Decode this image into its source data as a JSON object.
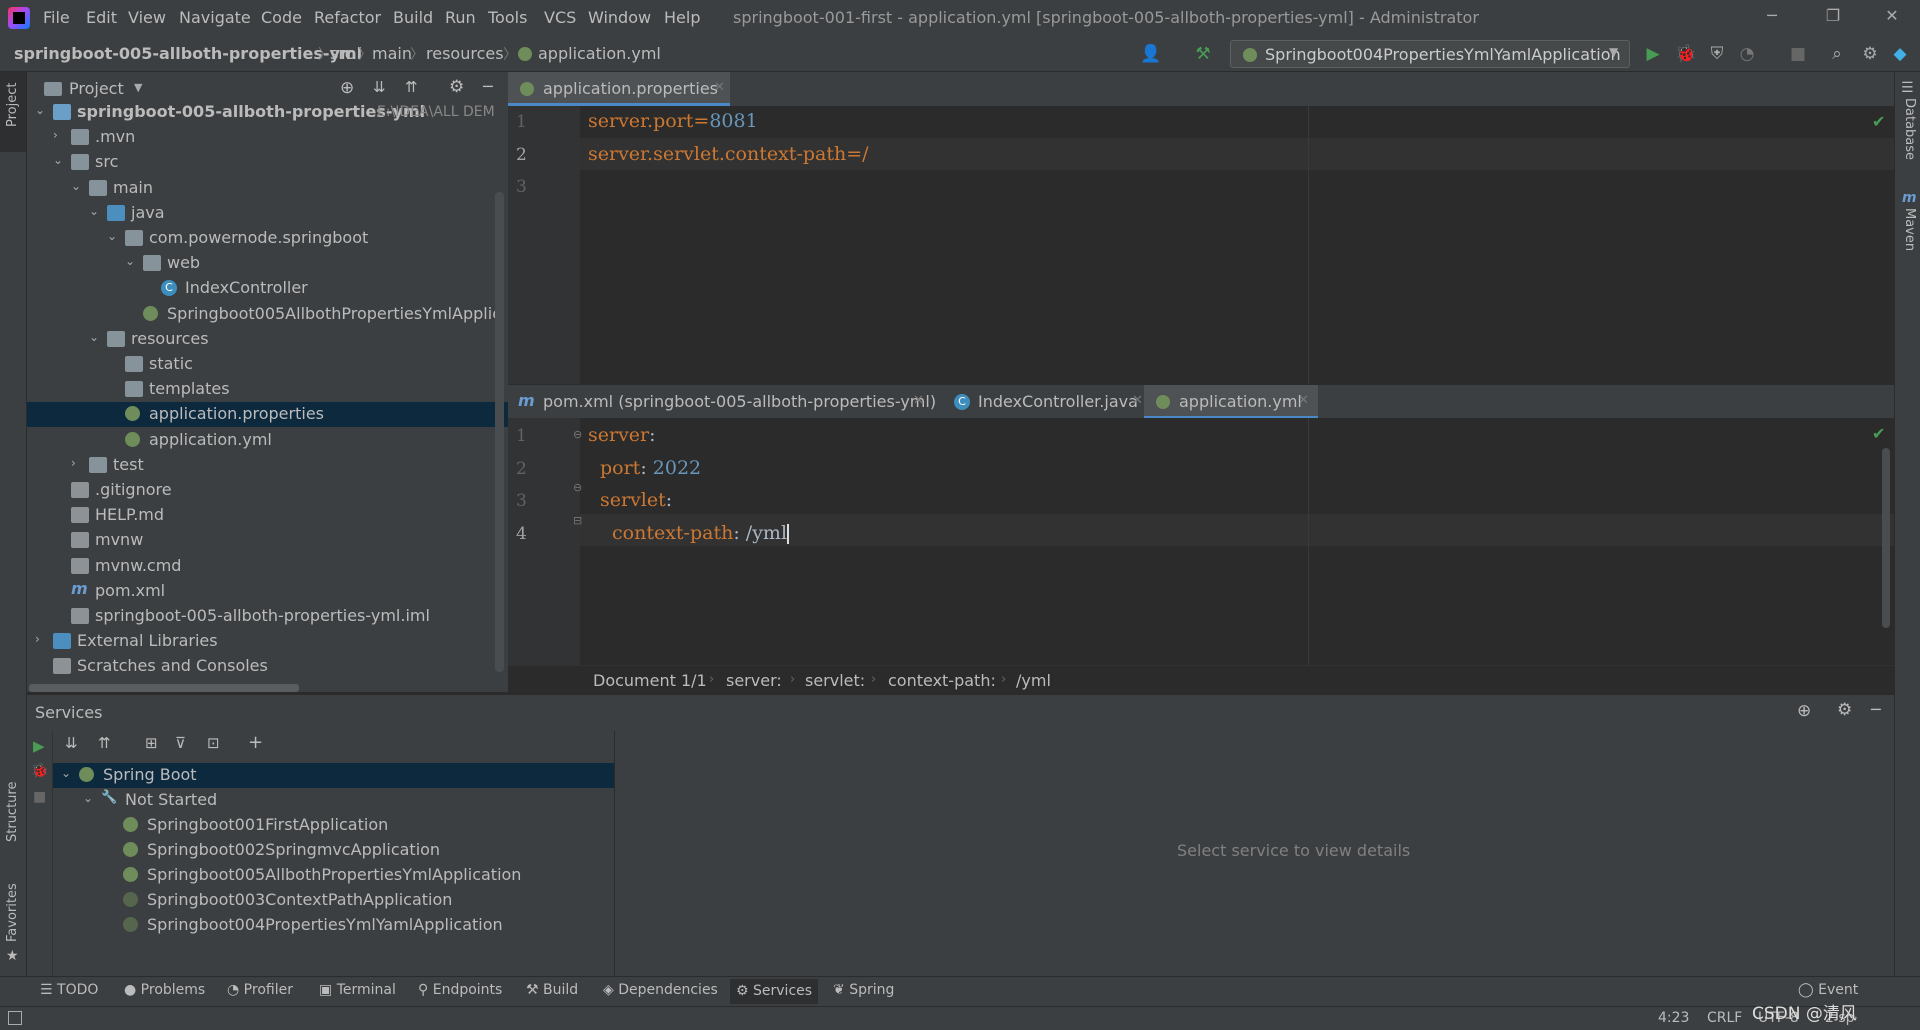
{
  "menu": [
    "File",
    "Edit",
    "View",
    "Navigate",
    "Code",
    "Refactor",
    "Build",
    "Run",
    "Tools",
    "VCS",
    "Window",
    "Help"
  ],
  "window_title": "springboot-001-first - application.yml [springboot-005-allboth-properties-yml] - Administrator",
  "breadcrumb": [
    "springboot-005-allboth-properties-yml",
    "src",
    "main",
    "resources",
    "application.yml"
  ],
  "run_config": "Springboot004PropertiesYmlYamlApplication",
  "left_stripe": {
    "project": "Project",
    "structure": "Structure",
    "favorites": "Favorites"
  },
  "right_stripe": {
    "database": "Database",
    "maven": "Maven"
  },
  "project_panel": {
    "title": "Project",
    "tree": [
      {
        "label": "springboot-005-allboth-properties-yml",
        "hint": "E:\\IDEA\\ALL DEM",
        "depth": 0,
        "arrow": "down",
        "icon": "module-folder",
        "bold": true
      },
      {
        "label": ".mvn",
        "depth": 1,
        "arrow": "right",
        "icon": "folder"
      },
      {
        "label": "src",
        "depth": 1,
        "arrow": "down",
        "icon": "folder"
      },
      {
        "label": "main",
        "depth": 2,
        "arrow": "down",
        "icon": "folder"
      },
      {
        "label": "java",
        "depth": 3,
        "arrow": "down",
        "icon": "source-folder"
      },
      {
        "label": "com.powernode.springboot",
        "depth": 4,
        "arrow": "down",
        "icon": "package"
      },
      {
        "label": "web",
        "depth": 5,
        "arrow": "down",
        "icon": "package"
      },
      {
        "label": "IndexController",
        "depth": 6,
        "arrow": "",
        "icon": "class"
      },
      {
        "label": "Springboot005AllbothPropertiesYmlApplic",
        "depth": 5,
        "arrow": "",
        "icon": "spring-class"
      },
      {
        "label": "resources",
        "depth": 3,
        "arrow": "down",
        "icon": "resources-folder"
      },
      {
        "label": "static",
        "depth": 4,
        "arrow": "",
        "icon": "folder"
      },
      {
        "label": "templates",
        "depth": 4,
        "arrow": "",
        "icon": "folder"
      },
      {
        "label": "application.properties",
        "depth": 4,
        "arrow": "",
        "icon": "spring-config",
        "selected": true
      },
      {
        "label": "application.yml",
        "depth": 4,
        "arrow": "",
        "icon": "spring-config"
      },
      {
        "label": "test",
        "depth": 2,
        "arrow": "right",
        "icon": "folder"
      },
      {
        "label": ".gitignore",
        "depth": 1,
        "arrow": "",
        "icon": "file"
      },
      {
        "label": "HELP.md",
        "depth": 1,
        "arrow": "",
        "icon": "md-file"
      },
      {
        "label": "mvnw",
        "depth": 1,
        "arrow": "",
        "icon": "file"
      },
      {
        "label": "mvnw.cmd",
        "depth": 1,
        "arrow": "",
        "icon": "file"
      },
      {
        "label": "pom.xml",
        "depth": 1,
        "arrow": "",
        "icon": "maven"
      },
      {
        "label": "springboot-005-allboth-properties-yml.iml",
        "depth": 1,
        "arrow": "",
        "icon": "file"
      },
      {
        "label": "External Libraries",
        "depth": 0,
        "arrow": "right",
        "icon": "library"
      },
      {
        "label": "Scratches and Consoles",
        "depth": 0,
        "arrow": "",
        "icon": "scratch"
      }
    ]
  },
  "editor_top": {
    "tab": "application.properties",
    "lines": [
      {
        "n": "1",
        "key": "server.port",
        "eq": "=",
        "val": "8081"
      },
      {
        "n": "2",
        "key": "server.servlet.context-path",
        "eq": "=",
        "val": "/"
      },
      {
        "n": "3",
        "key": "",
        "eq": "",
        "val": ""
      }
    ]
  },
  "editor_bottom": {
    "tabs": [
      {
        "label": "pom.xml (springboot-005-allboth-properties-yml)",
        "icon": "maven"
      },
      {
        "label": "IndexController.java",
        "icon": "class"
      },
      {
        "label": "application.yml",
        "icon": "spring-config",
        "active": true
      }
    ],
    "lines": [
      {
        "n": "1",
        "key": "server",
        "colon": ":",
        "val": ""
      },
      {
        "n": "2",
        "key": "port",
        "colon": ": ",
        "val": "2022"
      },
      {
        "n": "3",
        "key": "servlet",
        "colon": ":",
        "val": ""
      },
      {
        "n": "4",
        "key": "context-path",
        "colon": ": ",
        "val": "/yml"
      }
    ],
    "crumbs": [
      "Document 1/1",
      "server:",
      "servlet:",
      "context-path:",
      "/yml"
    ]
  },
  "services": {
    "title": "Services",
    "tree": [
      {
        "label": "Spring Boot",
        "depth": 0,
        "arrow": "down",
        "selected": true
      },
      {
        "label": "Not Started",
        "depth": 1,
        "arrow": "down"
      },
      {
        "label": "Springboot001FirstApplication",
        "depth": 2
      },
      {
        "label": "Springboot002SpringmvcApplication",
        "depth": 2
      },
      {
        "label": "Springboot005AllbothPropertiesYmlApplication",
        "depth": 2
      },
      {
        "label": "Springboot003ContextPathApplication",
        "depth": 2,
        "dim": true
      },
      {
        "label": "Springboot004PropertiesYmlYamlApplication",
        "depth": 2,
        "dim": true
      }
    ],
    "detail_placeholder": "Select service to view details"
  },
  "bottom_tools": [
    "TODO",
    "Problems",
    "Profiler",
    "Terminal",
    "Endpoints",
    "Build",
    "Dependencies",
    "Services",
    "Spring"
  ],
  "status": {
    "event_log": "Event",
    "position": "4:23",
    "line_sep": "CRLF",
    "encoding": "UTF-8",
    "indent": "2 sp",
    "watermark": "CSDN @清风"
  },
  "colors": {
    "key": "#cc7832",
    "number": "#6897bb",
    "selection": "#0d293e",
    "accent": "#4a88c7"
  }
}
